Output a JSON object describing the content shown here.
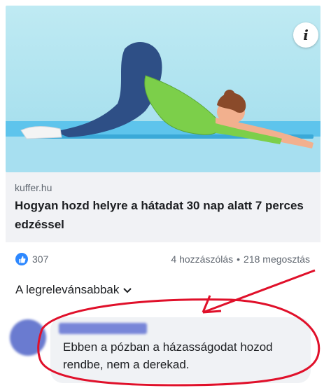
{
  "post": {
    "image_alt": "Woman in child's pose yoga stretch",
    "info_icon": "i",
    "link_domain": "kuffer.hu",
    "link_title": "Hogyan hozd helyre a hátadat 30 nap alatt 7 perces edzéssel"
  },
  "engagement": {
    "reactions_count": "307",
    "comments_text": "4 hozzászólás",
    "separator": "•",
    "shares_text": "218 megosztás"
  },
  "comments": {
    "sort_label": "A legrelevánsabbak",
    "items": [
      {
        "author": "",
        "text": "Ebben a pózban a házasságodat hozod rendbe, nem a derekad."
      }
    ]
  },
  "colors": {
    "like_blue": "#2d88ff",
    "annotation_red": "#e0102a",
    "link_card_bg": "#f1f2f5"
  }
}
